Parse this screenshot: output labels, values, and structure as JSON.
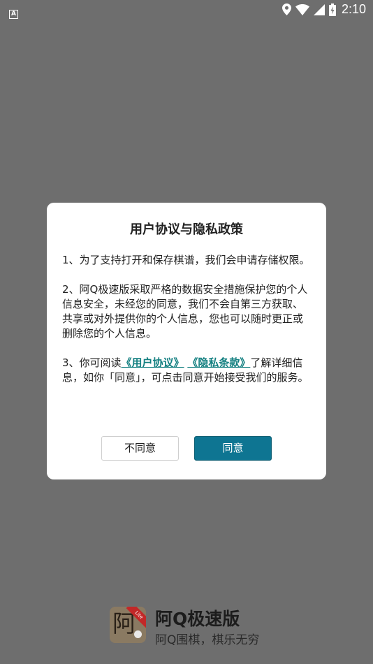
{
  "status_bar": {
    "time": "2:10",
    "left_icon": "A",
    "icons": [
      "location-icon",
      "wifi-icon",
      "cell-signal-icon",
      "battery-charging-icon"
    ]
  },
  "dialog": {
    "title": "用户协议与隐私政策",
    "para1": "1、为了支持打开和保存棋谱，我们会申请存储权限。",
    "para2": " 2、阿Q极速版采取严格的数据安全措施保护您的个人信息安全，未经您的同意，我们不会自第三方获取、共享或对外提供你的个人信息，您也可以随时更正或删除您的个人信息。",
    "para3_prefix": " 3、你可阅读",
    "user_agreement_link": "《用户协议》",
    "privacy_link": "《隐私条款》",
    "para3_suffix": "了解详细信息，如你「同意」，可点击同意开始接受我们的服务。",
    "disagree_label": "不同意",
    "agree_label": "同意",
    "link_color": "#127f80",
    "agree_color": "#0e7592"
  },
  "brand": {
    "logo_char": "阿",
    "logo_badge": "Lite",
    "name": "阿Q极速版",
    "slogan": "阿Q围棋，棋乐无穷"
  }
}
